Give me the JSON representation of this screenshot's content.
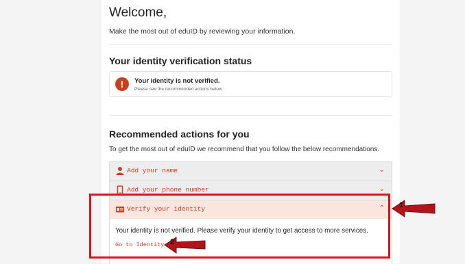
{
  "welcome": {
    "title": "Welcome,",
    "subtitle": "Make the most out of eduID by reviewing your information."
  },
  "identity_status": {
    "section_title": "Your identity verification status",
    "status_title": "Your identity is not verified.",
    "status_subtitle": "Please see the recommended actions below.",
    "icon": "alert-icon"
  },
  "recommended": {
    "section_title": "Recommended actions for you",
    "intro": "To get the most out of eduID we recommend that you follow the below recommendations.",
    "items": [
      {
        "label": "Add your name",
        "icon": "person-icon",
        "expanded": false
      },
      {
        "label": "Add your phone number",
        "icon": "phone-icon",
        "expanded": false
      },
      {
        "label": "Verify your identity",
        "icon": "id-card-icon",
        "expanded": true,
        "body": "Your identity is not verified. Please verify your identity to get access to more services.",
        "link": "Go to Identity"
      }
    ]
  },
  "annotations": {
    "marker_1": "1",
    "marker_2": "2",
    "highlight_color": "#d8141a"
  },
  "colors": {
    "accent": "#c8401e",
    "active_row_bg": "#fbe6df"
  }
}
